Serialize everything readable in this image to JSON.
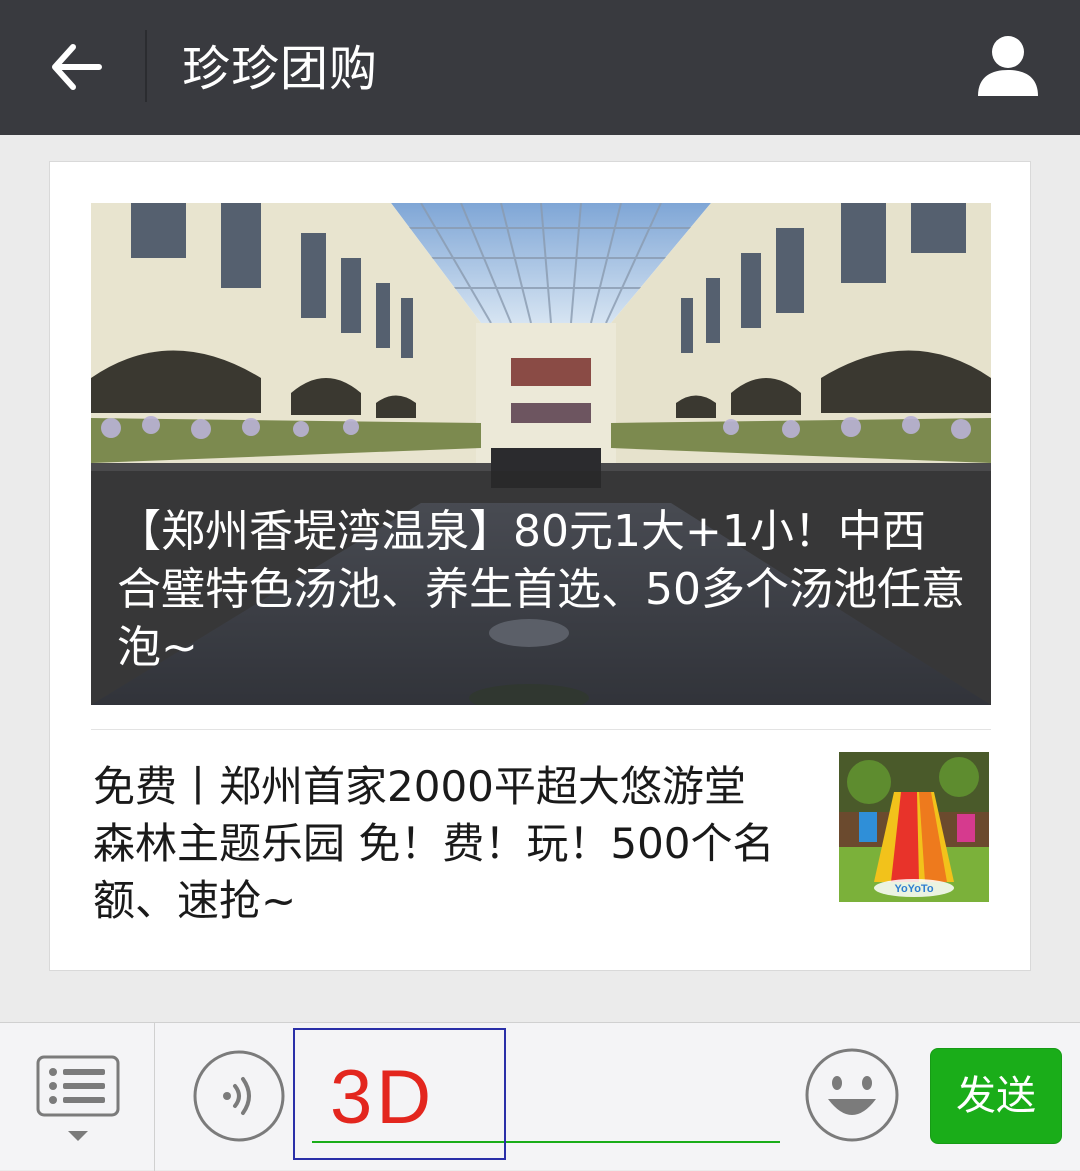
{
  "header": {
    "title": "珍珍团购",
    "back_icon": "back-arrow-icon",
    "profile_icon": "person-icon"
  },
  "feed": {
    "cover_article": {
      "title": "【郑州香堤湾温泉】80元1大+1小！中西合璧特色汤池、养生首选、50多个汤池任意泡~",
      "image": "indoor-hot-spring-atrium-photo"
    },
    "list_article": {
      "title": "免费丨郑州首家2000平超大悠游堂森林主题乐园 免！费！玩！500个名额、速抢~",
      "image": "indoor-playground-slide-photo",
      "image_caption": "YoYoTo"
    }
  },
  "input_bar": {
    "menu_icon": "menu-list-icon",
    "voice_icon": "voice-icon",
    "input_value": "3D",
    "emoji_icon": "smiley-icon",
    "send_label": "发送"
  },
  "colors": {
    "header_bg": "#393a3f",
    "send_green": "#1aad19",
    "input_text": "#e3261e",
    "highlight_border": "#2a2fa8"
  }
}
